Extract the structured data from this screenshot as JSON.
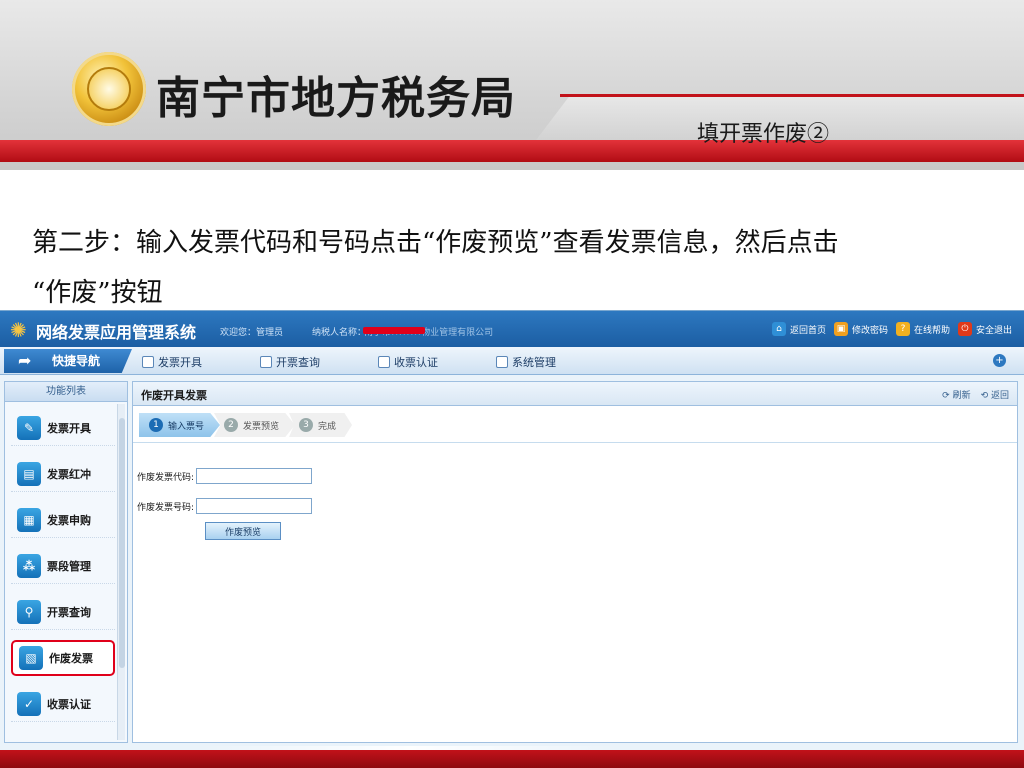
{
  "slide": {
    "org_title": "南宁市地方税务局",
    "subtitle": "填开票作废②",
    "instruction_line1": "第二步：输入发票代码和号码点击“作废预览”查看发票信息，然后点击",
    "instruction_line2": "“作废”按钮"
  },
  "app": {
    "name": "网络发票应用管理系统",
    "welcome": "欢迎您：管理员",
    "taxpayer_label": "纳税人名称：",
    "taxpayer_name": "南宁市××××物业管理有限公司",
    "top_links": [
      {
        "label": "返回首页",
        "icon": "home-icon",
        "color": "#2f8fd6"
      },
      {
        "label": "修改密码",
        "icon": "lock-icon",
        "color": "#f0a020"
      },
      {
        "label": "在线帮助",
        "icon": "help-icon",
        "color": "#f0b020"
      },
      {
        "label": "安全退出",
        "icon": "power-icon",
        "color": "#e0391a"
      }
    ],
    "nav": {
      "quick_nav": "快捷导航",
      "items": [
        "发票开具",
        "开票查询",
        "收票认证",
        "系统管理"
      ]
    },
    "sidebar": {
      "header": "功能列表",
      "items": [
        {
          "label": "发票开具",
          "icon": "edit-invoice-icon"
        },
        {
          "label": "发票红冲",
          "icon": "document-icon"
        },
        {
          "label": "发票申购",
          "icon": "purchase-icon"
        },
        {
          "label": "票段管理",
          "icon": "network-icon"
        },
        {
          "label": "开票查询",
          "icon": "search-icon"
        },
        {
          "label": "作废发票",
          "icon": "void-invoice-icon",
          "active": true
        },
        {
          "label": "收票认证",
          "icon": "check-icon"
        }
      ]
    },
    "main": {
      "title": "作废开具发票",
      "refresh": "刷新",
      "back": "返回",
      "steps": [
        {
          "num": "1",
          "label": "输入票号",
          "active": true
        },
        {
          "num": "2",
          "label": "发票预览",
          "active": false
        },
        {
          "num": "3",
          "label": "完成",
          "active": false
        }
      ],
      "code_label": "作废发票代码:",
      "code_value": "",
      "number_label": "作废发票号码:",
      "number_value": "",
      "preview_button": "作废预览"
    }
  },
  "colors": {
    "accent_red": "#c2121a",
    "app_blue": "#1c5ea3",
    "highlight": "#e0001a"
  }
}
